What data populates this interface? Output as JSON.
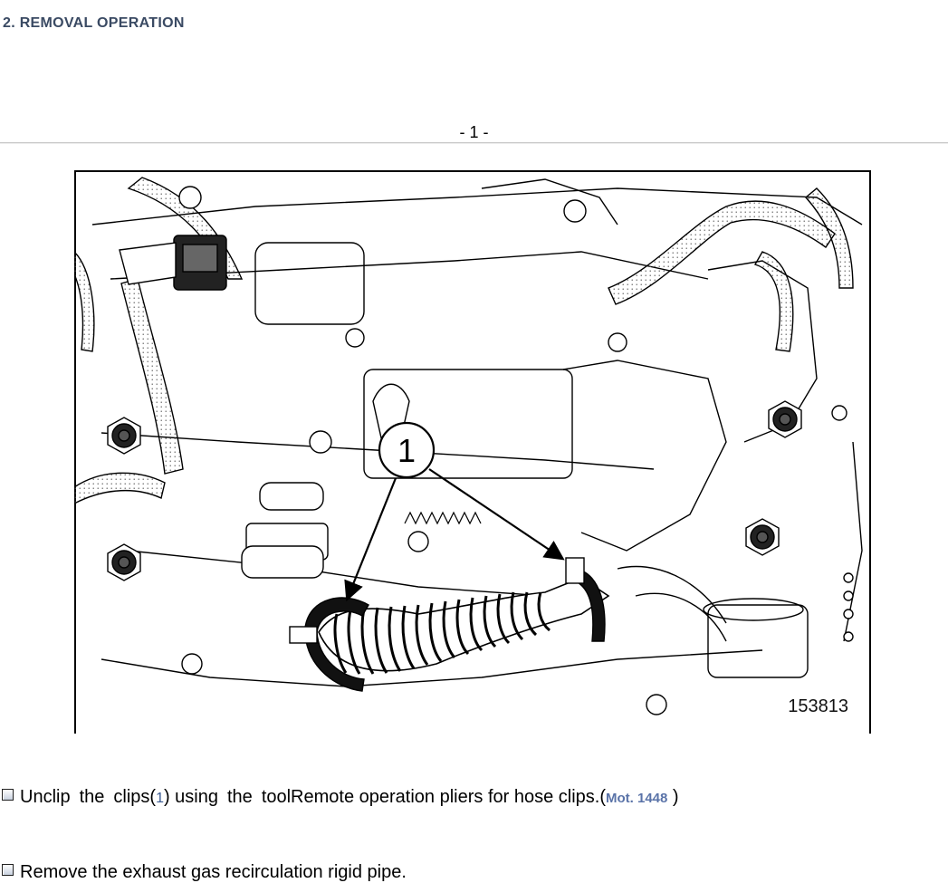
{
  "section": {
    "title": "2. REMOVAL OPERATION"
  },
  "page": {
    "number": "- 1 -"
  },
  "figure": {
    "reference": "153813",
    "callout_label": "1",
    "icons": [
      "engine-bay-illustration",
      "callout-1-icon",
      "arrow-icon",
      "hose-clip-icon",
      "corrugated-hose-icon"
    ]
  },
  "steps": [
    {
      "w1": "Unclip",
      "w2": "the",
      "w3": "clips(",
      "callout": "1",
      "w4": ") using",
      "w5": "the",
      "w6": "toolRemote operation pliers for hose clips.(",
      "tool_ref": "Mot. 1448",
      "tail": " )"
    },
    {
      "text": "Remove the exhaust gas recirculation rigid pipe."
    }
  ],
  "colors": {
    "title": "#3a4a63",
    "link": "#5a73a8"
  }
}
